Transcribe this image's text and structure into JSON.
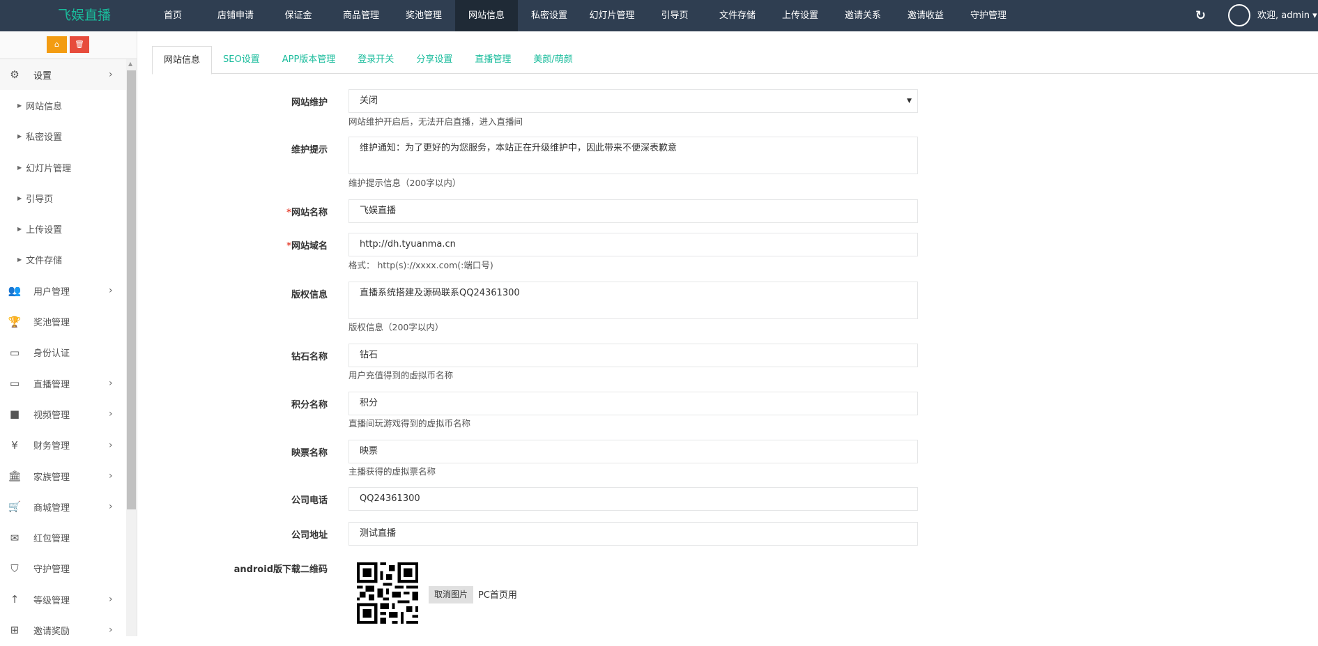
{
  "header": {
    "logo": "飞娱直播",
    "nav": [
      "首页",
      "店铺申请",
      "保证金",
      "商品管理",
      "奖池管理",
      "网站信息",
      "私密设置",
      "幻灯片管理",
      "引导页",
      "文件存储",
      "上传设置",
      "邀请关系",
      "邀请收益",
      "守护管理"
    ],
    "active_nav": "网站信息",
    "refresh_icon": "↻",
    "welcome": "欢迎, admin ▾"
  },
  "sidebar": {
    "home_icon": "⌂",
    "trash_icon": "🗑",
    "settings": {
      "label": "设置",
      "icon": "⚙",
      "chevron": "›"
    },
    "sub_items": [
      "网站信息",
      "私密设置",
      "幻灯片管理",
      "引导页",
      "上传设置",
      "文件存储"
    ],
    "items": [
      {
        "label": "用户管理",
        "icon": "👥",
        "chevron": "›"
      },
      {
        "label": "奖池管理",
        "icon": "🏆",
        "chevron": ""
      },
      {
        "label": "身份认证",
        "icon": "▭",
        "chevron": ""
      },
      {
        "label": "直播管理",
        "icon": "▭",
        "chevron": "›"
      },
      {
        "label": "视频管理",
        "icon": "■",
        "chevron": "›"
      },
      {
        "label": "财务管理",
        "icon": "¥",
        "chevron": "›"
      },
      {
        "label": "家族管理",
        "icon": "🏛",
        "chevron": "›"
      },
      {
        "label": "商城管理",
        "icon": "🛒",
        "chevron": "›"
      },
      {
        "label": "红包管理",
        "icon": "✉",
        "chevron": ""
      },
      {
        "label": "守护管理",
        "icon": "⛉",
        "chevron": ""
      },
      {
        "label": "等级管理",
        "icon": "↑",
        "chevron": "›"
      },
      {
        "label": "邀请奖励",
        "icon": "⊞",
        "chevron": "›"
      }
    ]
  },
  "tabs": [
    "网站信息",
    "SEO设置",
    "APP版本管理",
    "登录开关",
    "分享设置",
    "直播管理",
    "美颜/萌颜"
  ],
  "form": {
    "maintenance": {
      "label": "网站维护",
      "value": "关闭",
      "help": "网站维护开启后，无法开启直播，进入直播间"
    },
    "maintenance_tip": {
      "label": "维护提示",
      "value": "维护通知：为了更好的为您服务，本站正在升级维护中，因此带来不便深表歉意",
      "help": "维护提示信息（200字以内）"
    },
    "site_name": {
      "required": "*",
      "label": "网站名称",
      "value": "飞娱直播"
    },
    "site_domain": {
      "required": "*",
      "label": "网站域名",
      "value": "http://dh.tyuanma.cn",
      "help": "格式： http(s)://xxxx.com(:端口号)"
    },
    "copyright": {
      "label": "版权信息",
      "value": "直播系统搭建及源码联系QQ24361300",
      "help": "版权信息（200字以内）"
    },
    "diamond": {
      "label": "钻石名称",
      "value": "钻石",
      "help": "用户充值得到的虚拟币名称"
    },
    "points": {
      "label": "积分名称",
      "value": "积分",
      "help": "直播间玩游戏得到的虚拟币名称"
    },
    "ticket": {
      "label": "映票名称",
      "value": "映票",
      "help": "主播获得的虚拟票名称"
    },
    "phone": {
      "label": "公司电话",
      "value": "QQ24361300"
    },
    "address": {
      "label": "公司地址",
      "value": "测试直播"
    },
    "qrcode": {
      "label": "android版下载二维码",
      "cancel": "取消图片",
      "note": "PC首页用"
    }
  }
}
